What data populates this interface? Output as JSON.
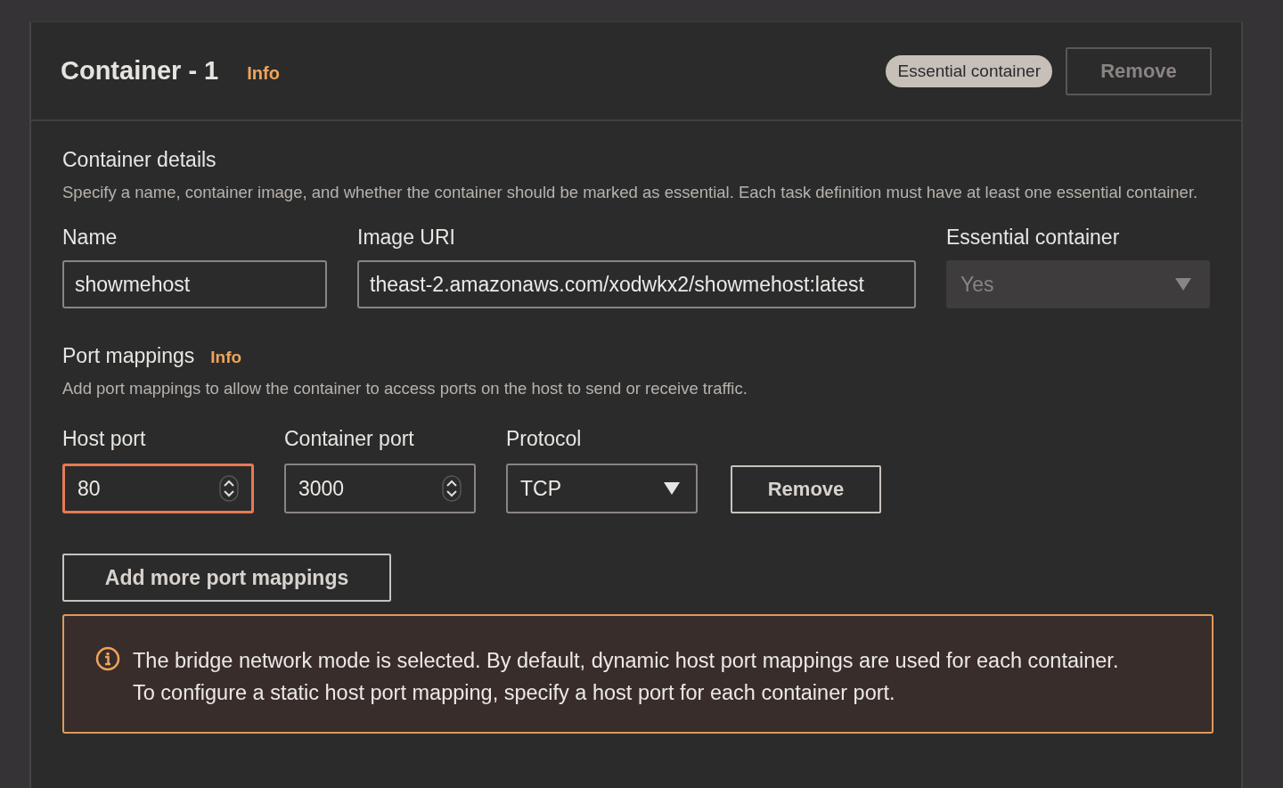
{
  "container": {
    "title": "Container - 1",
    "info": "Info",
    "badge": "Essential container",
    "remove": {
      "label": "Remove",
      "disabled": true
    }
  },
  "details": {
    "heading": "Container details",
    "description": "Specify a name, container image, and whether the container should be marked as essential. Each task definition must have at least one essential container.",
    "fields": [
      {
        "kind": "text",
        "label": "Name",
        "value": "showmehost",
        "disabled": false
      },
      {
        "kind": "text",
        "label": "Image URI",
        "value": "theast-2.amazonaws.com/xodwkx2/showmehost:latest",
        "disabled": false
      },
      {
        "kind": "select",
        "label": "Essential container",
        "value": "Yes",
        "disabled": true
      }
    ]
  },
  "port_mappings": {
    "heading": "Port mappings",
    "info": "Info",
    "description": "Add port mappings to allow the container to access ports on the host to send or receive traffic.",
    "fields": [
      {
        "kind": "number",
        "label": "Host port",
        "value": "80",
        "focused": true
      },
      {
        "kind": "number",
        "label": "Container port",
        "value": "3000",
        "focused": false
      },
      {
        "kind": "select",
        "label": "Protocol",
        "value": "TCP",
        "focused": false
      }
    ],
    "remove": "Remove",
    "add": "Add more port mappings"
  },
  "alert": {
    "lines": [
      "The bridge network mode is selected. By default, dynamic host port mappings are used for each container.",
      "To configure a static host port mapping, specify a host port for each container port."
    ]
  }
}
